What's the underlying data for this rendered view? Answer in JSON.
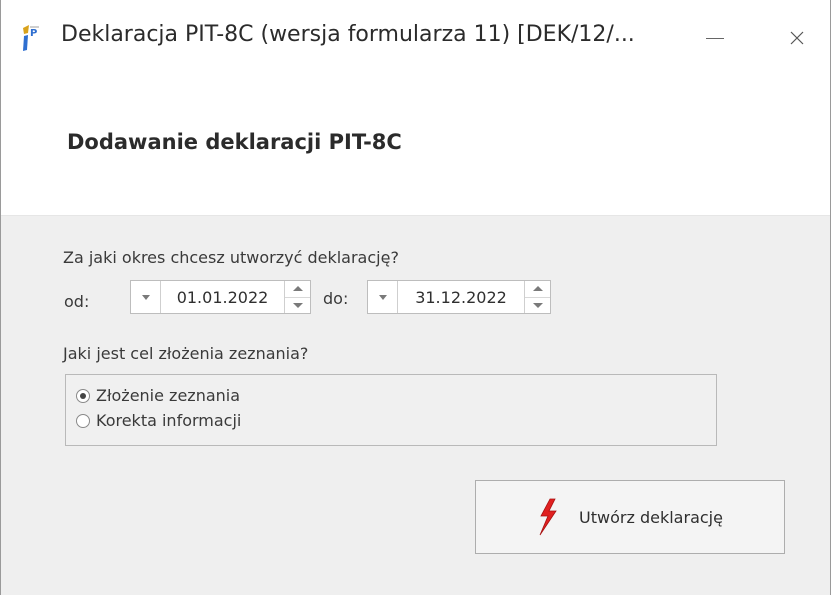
{
  "window": {
    "title": "Deklaracja PIT-8C (wersja formularza 11) [DEK/12/...",
    "minimize_icon": "minimize-icon",
    "close_glyph": "✕"
  },
  "header": {
    "title": "Dodawanie deklaracji PIT-8C"
  },
  "period": {
    "question": "Za jaki okres chcesz utworzyć deklarację?",
    "from_label": "od:",
    "from_value": "01.01.2022",
    "to_label": "do:",
    "to_value": "31.12.2022"
  },
  "purpose": {
    "question": "Jaki jest cel złożenia zeznania?",
    "options": [
      {
        "label": "Złożenie zeznania",
        "selected": true
      },
      {
        "label": "Korekta informacji",
        "selected": false
      }
    ]
  },
  "actions": {
    "create_label": "Utwórz deklarację",
    "create_icon": "lightning-bolt-icon",
    "accent_color": "#e02020"
  }
}
